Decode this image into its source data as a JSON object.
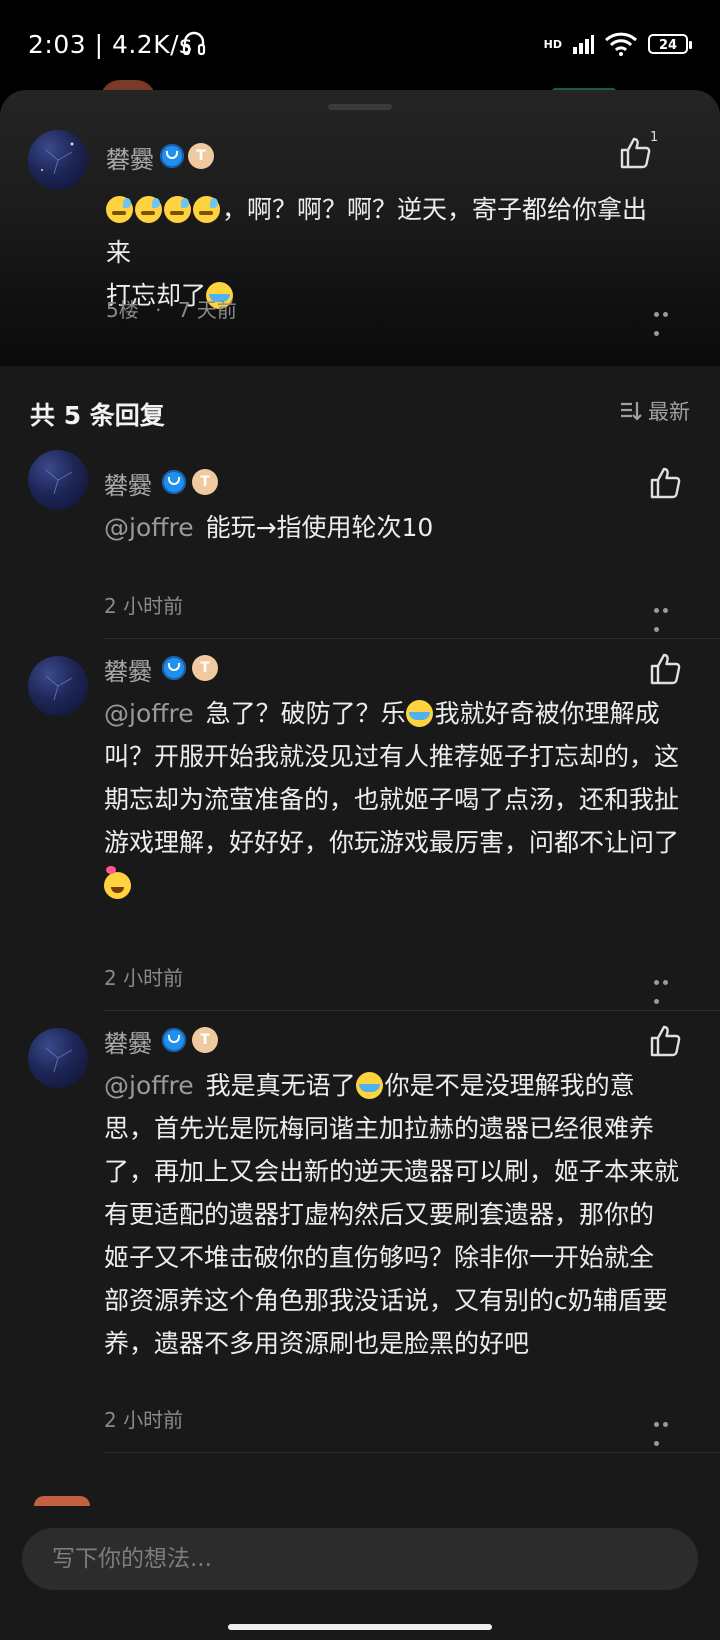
{
  "status": {
    "time": "2:03 | 4.2K/s",
    "network": "HD",
    "battery": "24"
  },
  "top_comment": {
    "username": "礬爨",
    "level_badge": "T",
    "likes": "1",
    "text_prefix": "，啊？啊？啊？逆天，寄子都给你拿出来",
    "text_line2": "打忘却了",
    "floor": "5楼",
    "dot": "·",
    "time": "7 天前"
  },
  "replies_header": {
    "title": "共 5 条回复",
    "sort_label": "最新"
  },
  "replies": [
    {
      "username": "礬爨",
      "level_badge": "T",
      "mention": "@joffre",
      "lines": [
        "能玩→指使用轮次10"
      ],
      "time": "2 小时前"
    },
    {
      "username": "礬爨",
      "level_badge": "T",
      "mention": "@joffre",
      "line1_a": "急了？破防了？乐",
      "line1_b": "我就好奇被你理解成",
      "lines": [
        "叫？开服开始我就没见过有人推荐姬子打忘却的，这",
        "期忘却为流萤准备的，也就姬子喝了点汤，还和我扯",
        "游戏理解，好好好，你玩游戏最厉害，问都不让问了"
      ],
      "time": "2 小时前"
    },
    {
      "username": "礬爨",
      "level_badge": "T",
      "mention": "@joffre",
      "line1_a": "我是真无语了",
      "line1_b": "你是不是没理解我的意",
      "lines": [
        "思，首先光是阮梅同谐主加拉赫的遗器已经很难养",
        "了，再加上又会出新的逆天遗器可以刷，姬子本来就",
        "有更适配的遗器打虚构然后又要刷套遗器，那你的",
        "姬子又不堆击破你的直伤够吗？除非你一开始就全",
        "部资源养这个角色那我没话说，又有别的c奶辅盾要",
        "养，遗器不多用资源刷也是脸黑的好吧"
      ],
      "time": "2 小时前"
    }
  ],
  "input": {
    "placeholder": "写下你的想法..."
  }
}
